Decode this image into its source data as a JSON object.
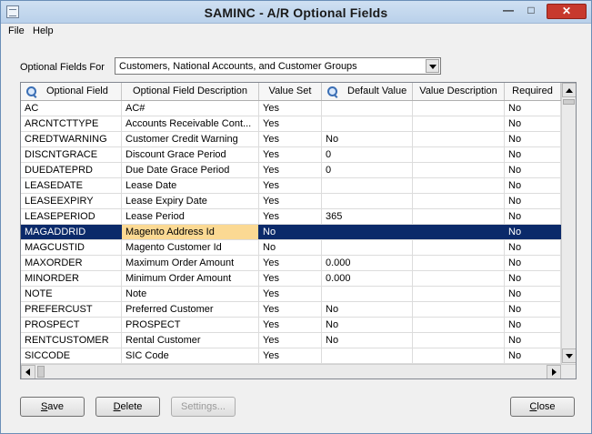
{
  "window": {
    "title": "SAMINC - A/R Optional Fields"
  },
  "menu": {
    "file": "File",
    "help": "Help"
  },
  "filter": {
    "label": "Optional Fields For",
    "value": "Customers, National Accounts, and Customer Groups"
  },
  "table": {
    "columns": [
      {
        "label": "Optional Field",
        "searchable": true
      },
      {
        "label": "Optional Field Description",
        "searchable": false
      },
      {
        "label": "Value Set",
        "searchable": false
      },
      {
        "label": "Default Value",
        "searchable": true
      },
      {
        "label": "Value Description",
        "searchable": false
      },
      {
        "label": "Required",
        "searchable": false
      }
    ],
    "selected_row": 9,
    "rows": [
      [
        "AC",
        "AC#",
        "Yes",
        "",
        "",
        "No"
      ],
      [
        "ARCNTCTTYPE",
        "Accounts Receivable Cont...",
        "Yes",
        "",
        "",
        "No"
      ],
      [
        "CREDTWARNING",
        "Customer Credit Warning",
        "Yes",
        "No",
        "",
        "No"
      ],
      [
        "DISCNTGRACE",
        "Discount Grace Period",
        "Yes",
        "0",
        "",
        "No"
      ],
      [
        "DUEDATEPRD",
        "Due Date Grace Period",
        "Yes",
        "0",
        "",
        "No"
      ],
      [
        "LEASEDATE",
        "Lease Date",
        "Yes",
        "",
        "",
        "No"
      ],
      [
        "LEASEEXPIRY",
        "Lease Expiry Date",
        "Yes",
        "",
        "",
        "No"
      ],
      [
        "LEASEPERIOD",
        "Lease Period",
        "Yes",
        "365",
        "",
        "No"
      ],
      [
        "MAGADDRID",
        "Magento Address Id",
        "No",
        "",
        "",
        "No"
      ],
      [
        "MAGCUSTID",
        "Magento Customer Id",
        "No",
        "",
        "",
        "No"
      ],
      [
        "MAXORDER",
        "Maximum Order Amount",
        "Yes",
        "0.000",
        "",
        "No"
      ],
      [
        "MINORDER",
        "Minimum Order Amount",
        "Yes",
        "0.000",
        "",
        "No"
      ],
      [
        "NOTE",
        "Note",
        "Yes",
        "",
        "",
        "No"
      ],
      [
        "PREFERCUST",
        "Preferred Customer",
        "Yes",
        "No",
        "",
        "No"
      ],
      [
        "PROSPECT",
        "PROSPECT",
        "Yes",
        "No",
        "",
        "No"
      ],
      [
        "RENTCUSTOMER",
        "Rental Customer",
        "Yes",
        "No",
        "",
        "No"
      ],
      [
        "SICCODE",
        "SIC Code",
        "Yes",
        "",
        "",
        "No"
      ]
    ]
  },
  "buttons": {
    "save": {
      "accel": "S",
      "rest": "ave"
    },
    "delete": {
      "accel": "D",
      "rest": "elete"
    },
    "settings": "Settings...",
    "close": {
      "accel": "C",
      "rest": "lose"
    }
  },
  "colors": {
    "selection": "#0b2a6a",
    "active_cell": "#fbd993",
    "close_button": "#c7392d"
  }
}
